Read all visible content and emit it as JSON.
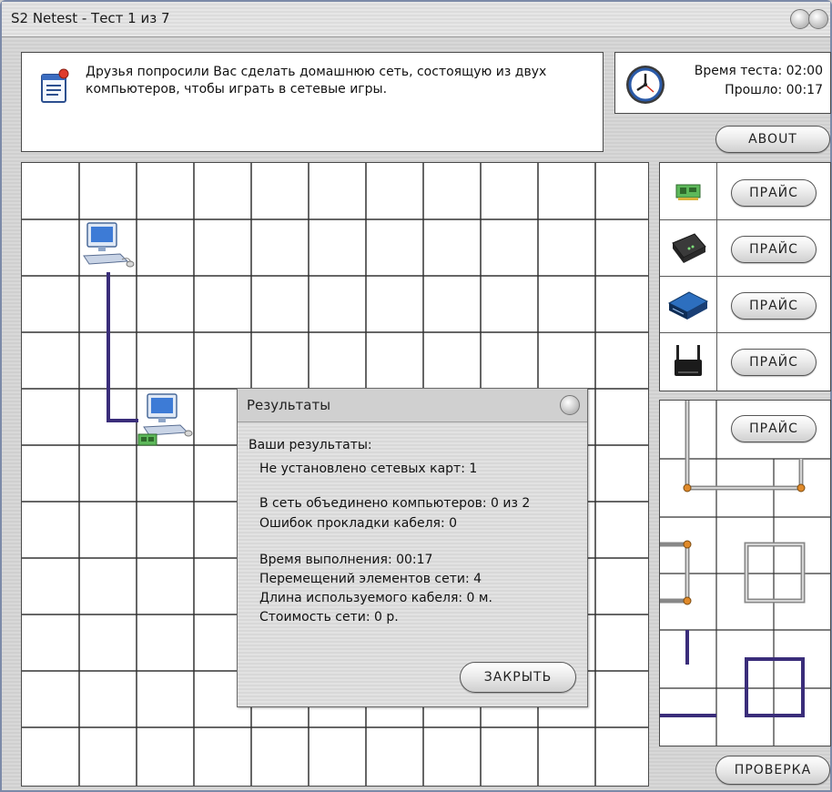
{
  "window": {
    "title": "S2 Netest - Тест 1 из 7"
  },
  "task": {
    "text": "Друзья попросили Вас сделать домашнюю сеть, состоящую из двух компьютеров, чтобы играть в сетевые игры.",
    "icon": "notepad-icon"
  },
  "timer": {
    "total_label": "Время теста: 02:00",
    "elapsed_label": "Прошло: 00:17",
    "icon": "clock-icon"
  },
  "about_button": "ABOUT",
  "components": [
    {
      "icon": "network-card-icon",
      "button": "ПРАЙС"
    },
    {
      "icon": "modem-icon",
      "button": "ПРАЙС"
    },
    {
      "icon": "switch-icon",
      "button": "ПРАЙС"
    },
    {
      "icon": "wifi-router-icon",
      "button": "ПРАЙС"
    }
  ],
  "cables": {
    "button": "ПРАЙС"
  },
  "check_button": "ПРОВЕРКА",
  "results_dialog": {
    "title": "Результаты",
    "heading": "Ваши результаты:",
    "lines": [
      "Не установлено сетевых карт: 1",
      "В сеть объединено компьютеров: 0 из 2",
      "Ошибок прокладки кабеля: 0",
      "Время выполнения: 00:17",
      "Перемещений элементов сети: 4",
      "Длина используемого кабеля: 0 м.",
      "Стоимость сети: 0 р."
    ],
    "close_button": "ЗАКРЫТЬ"
  },
  "colors": {
    "cable": "#3a2d7a",
    "node": "#e08a2a"
  }
}
